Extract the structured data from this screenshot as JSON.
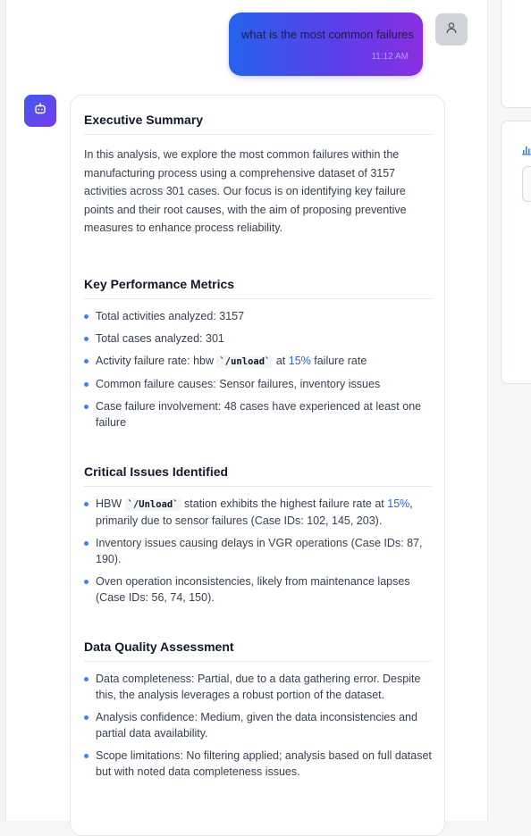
{
  "user_message": {
    "text": "what is the most common failures",
    "time": "11:12 AM"
  },
  "answer": {
    "executive_summary": {
      "title": "Executive Summary",
      "body": "In this analysis, we explore the most common failures within the manufacturing process using a comprehensive dataset of 3157 activities across 301 cases. Our focus is on identifying key failure points and their root causes, with the aim of proposing preventive measures to enhance process reliability."
    },
    "key_metrics": {
      "title": "Key Performance Metrics",
      "items": {
        "total_activities": "Total activities analyzed: 3157",
        "total_cases": "Total cases analyzed: 301",
        "activity_failure_prefix": "Activity failure rate: hbw ",
        "activity_failure_code": "`/unload`",
        "activity_failure_mid": " at ",
        "activity_failure_pct": "15%",
        "activity_failure_suffix": " failure rate",
        "causes": "Common failure causes: Sensor failures, inventory issues",
        "case_involvement": "Case failure involvement: 48 cases have experienced at least one failure"
      }
    },
    "critical_issues": {
      "title": "Critical Issues Identified",
      "items": {
        "hbw_prefix": "HBW ",
        "hbw_code": "`/Unload`",
        "hbw_mid": " station exhibits the highest failure rate at ",
        "hbw_pct": "15%",
        "hbw_suffix": ", primarily due to sensor failures (Case IDs: 102, 145, 203).",
        "inventory": "Inventory issues causing delays in VGR operations (Case IDs: 87, 190).",
        "oven": "Oven operation inconsistencies, likely from maintenance lapses (Case IDs: 56, 74, 150)."
      }
    },
    "data_quality": {
      "title": "Data Quality Assessment",
      "items": {
        "completeness": "Data completeness: Partial, due to a data gathering error. Despite this, the analysis leverages a robust portion of the dataset.",
        "confidence": "Analysis confidence: Medium, given the data inconsistencies and partial data availability.",
        "scope": "Scope limitations: No filtering applied; analysis based on full dataset but with noted data completeness issues."
      }
    }
  },
  "icons": {
    "user_avatar": "user-icon",
    "bot_avatar": "bot-icon",
    "side_panel": "bar-chart-icon"
  },
  "colors": {
    "accent_blue": "#2563eb",
    "gradient_start": "#2563eb",
    "gradient_end": "#8b2fe0"
  }
}
